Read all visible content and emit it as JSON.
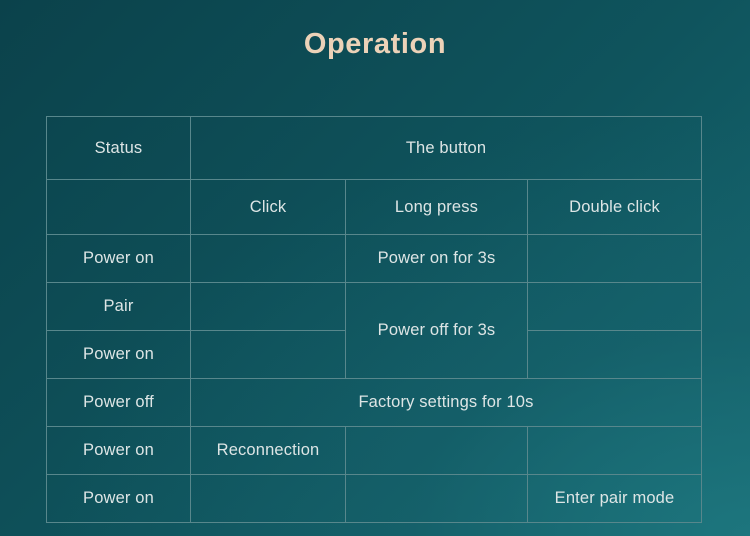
{
  "slide": {
    "title": "Operation",
    "colors": {
      "background_dark": "#0b424b",
      "background_light": "#176870",
      "title": "#ecd2b8",
      "table_border": "#58878c",
      "cell_text": "#dde5e5"
    }
  },
  "table": {
    "header": {
      "status_label": "Status",
      "button_label": "The button"
    },
    "subheader": {
      "blank": "",
      "click": "Click",
      "long_press": "Long press",
      "double_click": "Double click"
    },
    "rows": [
      {
        "status": "Power on",
        "click": "",
        "long_press": "Power on for 3s",
        "double_click": ""
      },
      {
        "status": "Pair",
        "click": "",
        "long_press": "Power off for 3s",
        "double_click": ""
      },
      {
        "status": "Power on",
        "click": "",
        "long_press": "",
        "double_click": ""
      },
      {
        "status": "Power off",
        "click": "",
        "long_press": "Factory settings for 10s",
        "double_click": ""
      },
      {
        "status": "Power on",
        "click": "Reconnection",
        "long_press": "",
        "double_click": ""
      },
      {
        "status": "Power on",
        "click": "",
        "long_press": "",
        "double_click": "Enter pair mode"
      }
    ]
  }
}
